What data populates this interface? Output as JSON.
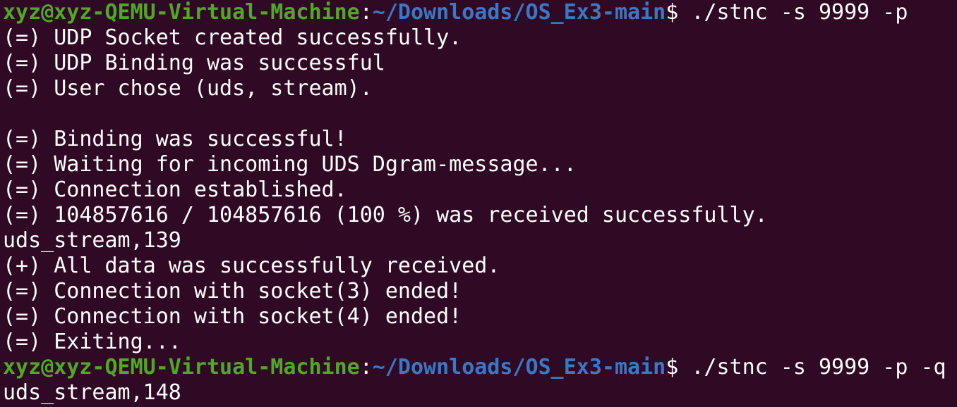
{
  "colors": {
    "background": "#300a24",
    "text": "#ffffff",
    "prompt_user": "#51a826",
    "prompt_path": "#3b78c4"
  },
  "prompt1": {
    "user_host": "xyz@xyz-QEMU-Virtual-Machine",
    "separator": ":",
    "path": "~/Downloads/OS_Ex3-main",
    "symbol": "$",
    "command": " ./stnc -s 9999 -p"
  },
  "output1": [
    "(=) UDP Socket created successfully.",
    "(=) UDP Binding was successful",
    "(=) User chose (uds, stream).",
    "",
    "(=) Binding was successful!",
    "(=) Waiting for incoming UDS Dgram-message...",
    "(=) Connection established.",
    "(=) 104857616 / 104857616 (100 %) was received successfully.",
    "uds_stream,139",
    "(+) All data was successfully received.",
    "(=) Connection with socket(3) ended!",
    "(=) Connection with socket(4) ended!",
    "(=) Exiting..."
  ],
  "prompt2": {
    "user_host": "xyz@xyz-QEMU-Virtual-Machine",
    "separator": ":",
    "path": "~/Downloads/OS_Ex3-main",
    "symbol": "$",
    "command": " ./stnc -s 9999 -p -q"
  },
  "output2": [
    "uds_stream,148"
  ]
}
